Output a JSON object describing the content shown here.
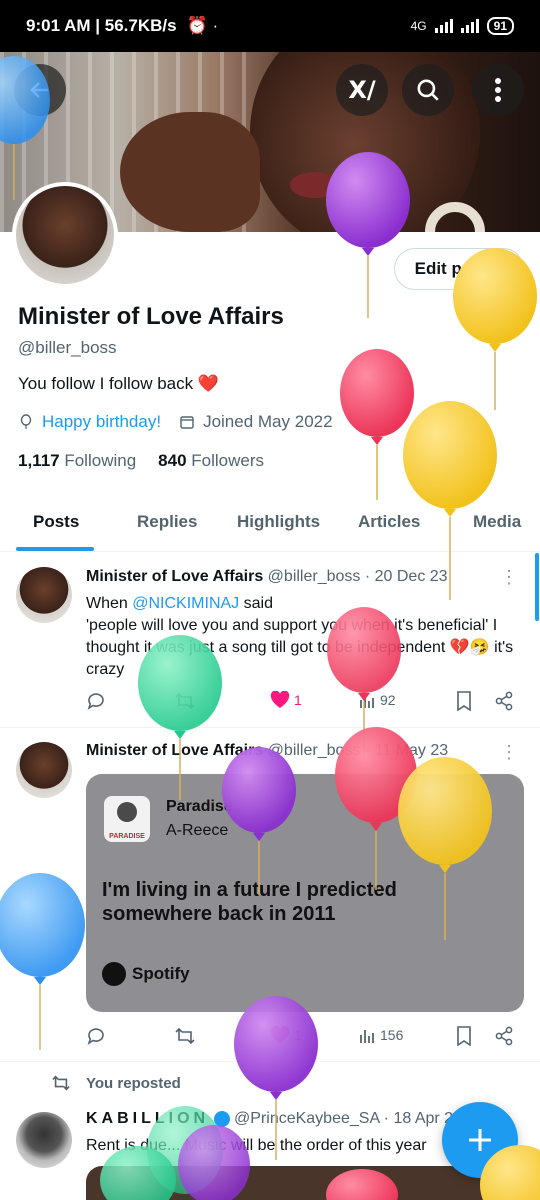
{
  "status_bar": {
    "time_speed": "9:01 AM | 56.7KB/s",
    "network": "4G",
    "battery": "91"
  },
  "profile": {
    "edit_label": "Edit profile",
    "name": "Minister of Love Affairs",
    "handle": "@biller_boss",
    "bio": "You follow I follow back",
    "bio_emoji": "❤️",
    "birthday": "Happy birthday!",
    "joined": "Joined May 2022",
    "following_count": "1,117",
    "following_label": "Following",
    "followers_count": "840",
    "followers_label": "Followers"
  },
  "tabs": [
    "Posts",
    "Replies",
    "Highlights",
    "Articles",
    "Media"
  ],
  "posts": [
    {
      "name": "Minister of Love Affairs",
      "meta": "@biller_boss · 20 Dec 23",
      "text_prefix": "When ",
      "mention": "@NICKIMINAJ",
      "text_suffix": " said",
      "text_line2": "'people will love you and support you when it's beneficial' I thought it was just a song till got to be independent 💔🤧 it's crazy",
      "likes": "1",
      "views": "92"
    },
    {
      "name": "Minister of Love Affairs",
      "meta": "@biller_boss · 11 May 23",
      "card_song": "Paradise",
      "card_artist": "A-Reece",
      "card_lyric": "I'm living in a future I predicted somewhere back in 2011",
      "card_brand": "Spotify",
      "thumb_label": "PARADISE",
      "likes": "1",
      "views": "156"
    }
  ],
  "repost": {
    "label": "You reposted",
    "name": "KABILLION",
    "meta": "@PrinceKaybee_SA · 18 Apr 2",
    "text": "Rent is due... Music will be the order of this year"
  },
  "colors": {
    "accent": "#1d9bf0",
    "like": "#f91880",
    "card": "#8e8e93"
  },
  "icons": {
    "back": "arrow-left-icon",
    "grok": "grok-icon",
    "search": "search-icon",
    "more": "more-vertical-icon",
    "compose": "plus-icon"
  }
}
